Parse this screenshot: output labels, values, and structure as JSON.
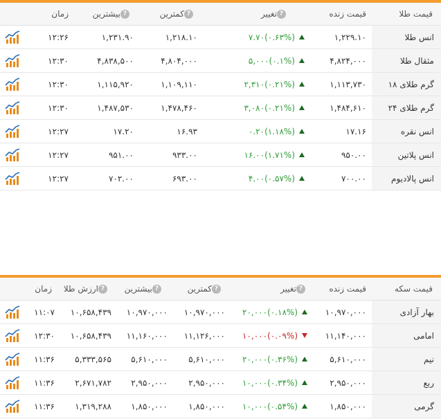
{
  "gold": {
    "headers": {
      "name": "قیمت طلا",
      "live": "قیمت زنده",
      "change": "تغییر",
      "low": "کمترین",
      "high": "بیشترین",
      "time": "زمان"
    },
    "rows": [
      {
        "name": "انس طلا",
        "live": "۱,۲۲۹.۱۰",
        "change_value": "۷.۷۰",
        "change_pct": "(۰.۶۳%)",
        "direction": "up",
        "low": "۱,۲۱۸.۱۰",
        "high": "۱,۲۳۱.۹۰",
        "time": "۱۲:۲۶"
      },
      {
        "name": "مثقال طلا",
        "live": "۴,۸۲۴,۰۰۰",
        "change_value": "۵,۰۰۰",
        "change_pct": "(۰.۱%)",
        "direction": "up",
        "low": "۴,۸۰۴,۰۰۰",
        "high": "۴,۸۳۸,۵۰۰",
        "time": "۱۲:۳۰"
      },
      {
        "name": "گرم طلای ۱۸",
        "live": "۱,۱۱۳,۷۳۰",
        "change_value": "۲,۳۱۰",
        "change_pct": "(۰.۲۱%)",
        "direction": "up",
        "low": "۱,۱۰۹,۱۱۰",
        "high": "۱,۱۱۵,۹۲۰",
        "time": "۱۲:۳۰"
      },
      {
        "name": "گرم طلای ۲۴",
        "live": "۱,۴۸۴,۶۱۰",
        "change_value": "۳,۰۸۰",
        "change_pct": "(۰.۲۱%)",
        "direction": "up",
        "low": "۱,۴۷۸,۴۶۰",
        "high": "۱,۴۸۷,۵۳۰",
        "time": "۱۲:۳۰"
      },
      {
        "name": "انس نقره",
        "live": "۱۷.۱۶",
        "change_value": "۰.۲۰",
        "change_pct": "(۱.۱۸%)",
        "direction": "up",
        "low": "۱۶.۹۳",
        "high": "۱۷.۲۰",
        "time": "۱۲:۲۷"
      },
      {
        "name": "انس پلاتین",
        "live": "۹۵۰.۰۰",
        "change_value": "۱۶.۰۰",
        "change_pct": "(۱.۷۱%)",
        "direction": "up",
        "low": "۹۳۳.۰۰",
        "high": "۹۵۱.۰۰",
        "time": "۱۲:۲۷"
      },
      {
        "name": "انس پالادیوم",
        "live": "۷۰۰.۰۰",
        "change_value": "۴.۰۰",
        "change_pct": "(۰.۵۷%)",
        "direction": "up",
        "low": "۶۹۳.۰۰",
        "high": "۷۰۲.۰۰",
        "time": "۱۲:۲۷"
      }
    ]
  },
  "coin": {
    "headers": {
      "name": "قیمت سکه",
      "live": "قیمت زنده",
      "change": "تغییر",
      "low": "کمترین",
      "high": "بیشترین",
      "gold_value": "ارزش طلا",
      "time": "زمان"
    },
    "rows": [
      {
        "name": "بهار آزادی",
        "live": "۱۰,۹۷۰,۰۰۰",
        "change_value": "۲۰,۰۰۰",
        "change_pct": "(۰.۱۸%)",
        "direction": "up",
        "low": "۱۰,۹۷۰,۰۰۰",
        "high": "۱۰,۹۷۰,۰۰۰",
        "gold_value": "۱۰,۶۵۸,۴۳۹",
        "time": "۱۱:۰۷"
      },
      {
        "name": "امامی",
        "live": "۱۱,۱۴۰,۰۰۰",
        "change_value": "۱۰,۰۰۰",
        "change_pct": "(۰.۰۹%)",
        "direction": "down",
        "low": "۱۱,۱۲۶,۰۰۰",
        "high": "۱۱,۱۶۰,۰۰۰",
        "gold_value": "۱۰,۶۵۸,۴۳۹",
        "time": "۱۲:۳۰"
      },
      {
        "name": "نیم",
        "live": "۵,۶۱۰,۰۰۰",
        "change_value": "۲۰,۰۰۰",
        "change_pct": "(۰.۳۶%)",
        "direction": "up",
        "low": "۵,۶۱۰,۰۰۰",
        "high": "۵,۶۱۰,۰۰۰",
        "gold_value": "۵,۳۳۳,۵۶۵",
        "time": "۱۱:۳۶"
      },
      {
        "name": "ربع",
        "live": "۲,۹۵۰,۰۰۰",
        "change_value": "۱۰,۰۰۰",
        "change_pct": "(۰.۳۴%)",
        "direction": "up",
        "low": "۲,۹۵۰,۰۰۰",
        "high": "۲,۹۵۰,۰۰۰",
        "gold_value": "۲,۶۷۱,۷۸۲",
        "time": "۱۱:۳۶"
      },
      {
        "name": "گرمی",
        "live": "۱,۸۵۰,۰۰۰",
        "change_value": "۱۰,۰۰۰",
        "change_pct": "(۰.۵۴%)",
        "direction": "up",
        "low": "۱,۸۵۰,۰۰۰",
        "high": "۱,۸۵۰,۰۰۰",
        "gold_value": "۱,۳۱۹,۲۸۸",
        "time": "۱۱:۳۶"
      }
    ]
  },
  "colors": {
    "accent": "#f39c2d",
    "positive": "#2f9e37",
    "negative": "#c62828",
    "icon_bars": "#e88a1a",
    "icon_line": "#2f6fb3"
  },
  "icons": {
    "chart": "chart-icon",
    "info": "info-icon",
    "up": "arrow-up-icon",
    "down": "arrow-down-icon"
  }
}
